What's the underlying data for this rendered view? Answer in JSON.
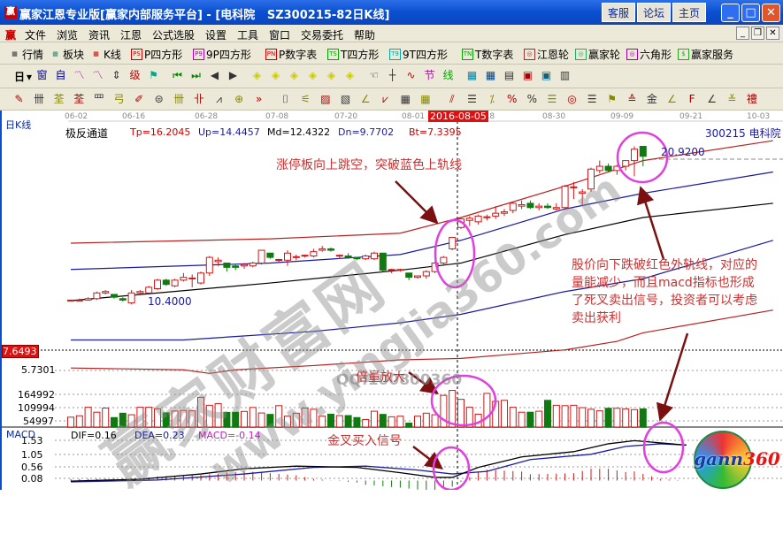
{
  "window": {
    "title": "赢家江恩专业版[赢家内部服务平台] - [电科院   SZ300215-82日K线]",
    "app_icon": "赢",
    "buttons": [
      "客服",
      "论坛",
      "主页"
    ],
    "controls": [
      "minimize",
      "maximize",
      "close"
    ]
  },
  "menu": {
    "logo": "赢",
    "items": [
      "文件",
      "浏览",
      "资讯",
      "江恩",
      "公式选股",
      "设置",
      "工具",
      "窗口",
      "交易委托",
      "帮助"
    ]
  },
  "toolbar1": [
    {
      "icon": "quote-table-icon",
      "badge": "",
      "label": "行情",
      "color": "#333"
    },
    {
      "icon": "sector-icon",
      "badge": "",
      "label": "板块",
      "color": "#2a8a6a"
    },
    {
      "icon": "kline-icon",
      "badge": "",
      "label": "K线",
      "color": "#c00"
    },
    {
      "icon": "ps-icon",
      "badge": "PS",
      "label": "P四方形",
      "color": "#c00"
    },
    {
      "icon": "p9-icon",
      "badge": "P9",
      "label": "9P四方形",
      "color": "#b0b"
    },
    {
      "icon": "pn-icon",
      "badge": "PN",
      "label": "P数字表",
      "color": "#c00"
    },
    {
      "icon": "ts-icon",
      "badge": "TS",
      "label": "T四方形",
      "color": "#0a0"
    },
    {
      "icon": "t9-icon",
      "badge": "T9",
      "label": "9T四方形",
      "color": "#0aa"
    },
    {
      "icon": "tn-icon",
      "badge": "TN",
      "label": "T数字表",
      "color": "#0a0"
    },
    {
      "icon": "gann-wheel-icon",
      "badge": "◎",
      "label": "江恩轮",
      "color": "#933"
    },
    {
      "icon": "winner-wheel-icon",
      "badge": "◎",
      "label": "赢家轮",
      "color": "#2a6"
    },
    {
      "icon": "hexagon-icon",
      "badge": "◎",
      "label": "六角形",
      "color": "#a0a"
    },
    {
      "icon": "dollar-icon",
      "badge": "$",
      "label": "赢家服务",
      "color": "#2a2"
    }
  ],
  "toolbar2": {
    "period": "日",
    "icons": [
      "window-icon",
      "self-select-icon",
      "period3-icon",
      "period9-icon",
      "candle-type-icon",
      "weight-icon",
      "flag-icon",
      "first-icon",
      "last-icon",
      "prev-icon",
      "next-icon",
      "gann-diamond1-icon",
      "gann-diamond2-icon",
      "gann-diamond3-icon",
      "gann-diamond4-icon",
      "gann-diamond5-icon",
      "gann-diamond6-icon",
      "hand-icon",
      "crosshair-icon",
      "wave-icon",
      "node-icon",
      "line-icon",
      "calendar-icon",
      "calculator-icon",
      "notes-icon",
      "save-icon",
      "network-icon",
      "print-icon"
    ]
  },
  "toolbar3": {
    "icons": [
      "pen-icon",
      "grid-icon",
      "gold-line1-icon",
      "gold-line2-icon",
      "fan1-icon",
      "spiral-icon",
      "pencil-icon",
      "circle-icon",
      "parallel-icon",
      "grid2-icon",
      "angle-icon",
      "target-icon",
      "more-icon",
      "box-icon",
      "fan-lines-icon",
      "square1-icon",
      "square2-icon",
      "angle2-icon",
      "wave2-icon",
      "grid3-icon",
      "grid4-icon",
      "slash-icon",
      "table-icon",
      "percent-line-icon",
      "percent-icon",
      "percent2-icon",
      "gold-circle-icon",
      "gold-line3-icon",
      "cone-icon",
      "fan3-icon",
      "gold4-icon",
      "angle3-icon",
      "fan4-icon",
      "gold5-icon",
      "fan5-icon",
      "fan6-icon",
      "fan7-icon"
    ]
  },
  "chart": {
    "period_label": "日K线",
    "dates": [
      "06-02",
      "06-16",
      "06-28",
      "07-08",
      "07-20",
      "08-01",
      "08-18",
      "08-30",
      "09-09",
      "09-21",
      "10-03"
    ],
    "selected_date": "2016-08-05",
    "indicator": {
      "name": "极反通道",
      "tp": "Tp=16.2045",
      "up": "Up=14.4457",
      "md": "Md=12.4322",
      "dn": "Dn=9.7702",
      "bt": "Bt=7.3395"
    },
    "stock": "300215 电科院",
    "high_label": "20.9200",
    "low_label": "10.4000",
    "cursor_price": "7.6493",
    "band_low_label": "5.7301",
    "volume_ticks": [
      "164992",
      "109994",
      "54997"
    ],
    "macd": {
      "name": "MACD",
      "dif": "DIF=0.16",
      "dea": "DEA=0.23",
      "macd": "MACD=-0.14",
      "ticks": [
        "1.53",
        "1.05",
        "0.56",
        "0.08"
      ]
    },
    "colors": {
      "up": "#d01818",
      "down": "#107a10",
      "band_outer": "#b82020",
      "band_inner": "#1a1aa0",
      "band_mid": "#000000",
      "dif": "#000000",
      "dea": "#1a1aa0",
      "annotation": "#c83232",
      "ellipse": "#e040e0",
      "arrow": "#7a1010"
    }
  },
  "chart_data": {
    "type": "candlestick",
    "candles_ohlc": [
      [
        10.45,
        10.5,
        10.4,
        10.5
      ],
      [
        10.5,
        10.6,
        10.45,
        10.5
      ],
      [
        10.5,
        10.7,
        10.45,
        10.6
      ],
      [
        10.6,
        11.1,
        10.5,
        11.0
      ],
      [
        11.0,
        11.2,
        10.9,
        11.1
      ],
      [
        10.9,
        10.9,
        10.6,
        10.7
      ],
      [
        10.6,
        10.7,
        10.4,
        10.5
      ],
      [
        10.3,
        11.2,
        10.2,
        11.0
      ],
      [
        11.0,
        11.2,
        10.9,
        11.1
      ],
      [
        11.0,
        11.5,
        10.9,
        11.4
      ],
      [
        11.3,
        12.0,
        11.2,
        11.9
      ],
      [
        11.9,
        12.0,
        11.5,
        11.6
      ],
      [
        11.5,
        12.0,
        11.4,
        11.9
      ],
      [
        11.9,
        12.4,
        11.8,
        12.1
      ],
      [
        12.0,
        12.3,
        11.4,
        12.05
      ],
      [
        11.7,
        12.5,
        11.6,
        12.4
      ],
      [
        12.4,
        13.6,
        12.2,
        13.5
      ],
      [
        13.2,
        13.5,
        12.9,
        13.3
      ],
      [
        13.1,
        13.1,
        12.5,
        12.8
      ],
      [
        12.9,
        13.0,
        12.6,
        12.8
      ],
      [
        12.9,
        13.1,
        12.7,
        13.0
      ],
      [
        12.9,
        13.2,
        12.8,
        13.1
      ],
      [
        13.1,
        14.0,
        13.0,
        14.0
      ],
      [
        13.8,
        13.8,
        13.4,
        13.5
      ],
      [
        13.3,
        13.4,
        13.1,
        13.35
      ],
      [
        13.3,
        14.0,
        12.9,
        13.8
      ],
      [
        13.5,
        13.7,
        13.3,
        13.55
      ],
      [
        13.6,
        13.7,
        13.5,
        13.65
      ],
      [
        13.6,
        14.1,
        13.5,
        13.9
      ],
      [
        14.0,
        14.3,
        13.9,
        14.1
      ],
      [
        14.1,
        14.2,
        13.9,
        14.0
      ],
      [
        13.6,
        13.7,
        13.4,
        13.65
      ],
      [
        13.6,
        13.8,
        13.4,
        13.5
      ],
      [
        13.5,
        13.5,
        13.3,
        13.4
      ],
      [
        13.4,
        13.7,
        13.3,
        13.6
      ],
      [
        13.4,
        13.9,
        13.3,
        13.8
      ],
      [
        13.8,
        13.8,
        12.5,
        12.6
      ],
      [
        12.6,
        12.7,
        12.4,
        12.65
      ],
      [
        12.6,
        12.7,
        12.5,
        12.65
      ],
      [
        12.4,
        12.4,
        11.9,
        12.1
      ],
      [
        12.1,
        12.2,
        12.0,
        12.2
      ],
      [
        12.2,
        12.6,
        12.0,
        12.5
      ],
      [
        12.5,
        13.2,
        12.4,
        13.1
      ],
      [
        13.1,
        13.6,
        12.9,
        13.5
      ],
      [
        14.1,
        14.9,
        14.0,
        14.9
      ],
      [
        15.6,
        16.3,
        15.5,
        16.2
      ],
      [
        16.1,
        16.4,
        15.7,
        16.25
      ],
      [
        16.0,
        16.5,
        15.8,
        16.4
      ],
      [
        16.3,
        16.5,
        16.1,
        16.35
      ],
      [
        16.4,
        17.1,
        16.2,
        16.6
      ],
      [
        16.6,
        16.9,
        16.4,
        16.7
      ],
      [
        16.8,
        17.4,
        16.6,
        17.3
      ],
      [
        17.1,
        17.5,
        16.9,
        17.2
      ],
      [
        17.3,
        17.5,
        16.9,
        17.0
      ],
      [
        17.0,
        17.3,
        16.8,
        17.1
      ],
      [
        17.1,
        17.3,
        16.9,
        17.0
      ],
      [
        16.9,
        17.3,
        16.8,
        17.0
      ],
      [
        17.0,
        18.6,
        16.9,
        18.5
      ],
      [
        18.4,
        18.8,
        17.6,
        18.45
      ],
      [
        18.0,
        18.3,
        17.2,
        18.1
      ],
      [
        18.3,
        19.8,
        18.1,
        19.7
      ],
      [
        19.6,
        20.3,
        19.4,
        19.9
      ],
      [
        19.9,
        20.1,
        19.5,
        19.6
      ],
      [
        19.6,
        20.0,
        19.3,
        19.9
      ],
      [
        19.9,
        20.3,
        19.6,
        20.3
      ],
      [
        20.3,
        21.3,
        19.2,
        21.1
      ],
      [
        21.3,
        21.3,
        19.9,
        20.6
      ]
    ],
    "volume_thousands": [
      50,
      57,
      100,
      75,
      96,
      48,
      70,
      62,
      100,
      100,
      92,
      72,
      81,
      84,
      82,
      150,
      110,
      118,
      74,
      75,
      79,
      99,
      71,
      64,
      108,
      55,
      70,
      96,
      90,
      55,
      65,
      58,
      58,
      48,
      38,
      80,
      64,
      52,
      55,
      20,
      55,
      70,
      62,
      160,
      185,
      140,
      100,
      65,
      170,
      130,
      135,
      100,
      75,
      75,
      80,
      135,
      110,
      108,
      110,
      98,
      90,
      82,
      95,
      95,
      92,
      88,
      92
    ],
    "bands": {
      "upper_outer": [
        [
          0,
          14.5
        ],
        [
          23,
          14.8
        ],
        [
          38,
          15.2
        ],
        [
          45,
          16.3
        ],
        [
          57,
          18.5
        ],
        [
          66,
          20.3
        ],
        [
          81,
          21.7
        ]
      ],
      "upper_inner": [
        [
          0,
          12.65
        ],
        [
          23,
          13.1
        ],
        [
          38,
          13.7
        ],
        [
          45,
          14.7
        ],
        [
          57,
          16.9
        ],
        [
          66,
          18.0
        ],
        [
          81,
          19.5
        ]
      ],
      "middle": [
        [
          0,
          10.46
        ],
        [
          23,
          11.7
        ],
        [
          38,
          12.6
        ],
        [
          45,
          13.1
        ],
        [
          57,
          15.1
        ],
        [
          66,
          16.3
        ],
        [
          81,
          17.3
        ]
      ],
      "lower_inner": [
        [
          0,
          7.7
        ],
        [
          13,
          7.7
        ],
        [
          28,
          8.3
        ],
        [
          38,
          8.9
        ],
        [
          45,
          9.5
        ],
        [
          57,
          11.1
        ],
        [
          66,
          12.0
        ],
        [
          81,
          14.7
        ]
      ],
      "lower_outer": [
        [
          0,
          5.73
        ],
        [
          13,
          5.6
        ],
        [
          16,
          5.35
        ],
        [
          19,
          5.6
        ],
        [
          28,
          5.9
        ],
        [
          38,
          6.3
        ],
        [
          45,
          6.4
        ],
        [
          53,
          6.8
        ],
        [
          57,
          7.0
        ],
        [
          63,
          7.6
        ],
        [
          66,
          8.2
        ],
        [
          81,
          9.8
        ]
      ]
    },
    "macd_dif": [
      [
        0,
        -0.02
      ],
      [
        8,
        0.05
      ],
      [
        15,
        0.25
      ],
      [
        20,
        0.45
      ],
      [
        26,
        0.55
      ],
      [
        33,
        0.5
      ],
      [
        38,
        0.3
      ],
      [
        42,
        0.12
      ],
      [
        44,
        0.12
      ],
      [
        47,
        0.5
      ],
      [
        52,
        0.9
      ],
      [
        58,
        1.1
      ],
      [
        62,
        1.4
      ],
      [
        65,
        1.52
      ],
      [
        71,
        1.35
      ]
    ],
    "macd_dea": [
      [
        0,
        -0.05
      ],
      [
        10,
        0.02
      ],
      [
        20,
        0.25
      ],
      [
        28,
        0.5
      ],
      [
        34,
        0.55
      ],
      [
        40,
        0.4
      ],
      [
        44,
        0.25
      ],
      [
        48,
        0.35
      ],
      [
        53,
        0.8
      ],
      [
        60,
        1.0
      ],
      [
        64,
        1.3
      ],
      [
        68,
        1.4
      ],
      [
        71,
        1.35
      ]
    ]
  },
  "annotations": {
    "gap_up": "涨停板向上跳空，突破蓝色上轨线",
    "sell_lines": [
      "股价向下跌破红色外轨线，对应的",
      "量能减少，而且macd指标也形成",
      "了死叉卖出信号，投资者可以考虑",
      "卖出获利"
    ],
    "volume": "倍量放大",
    "golden_cross": "金叉买入信号"
  },
  "watermark": {
    "main": "赢家财富网",
    "url": "www.yingjia360.com",
    "qq": "QQ:100800360",
    "logo": "gann360"
  }
}
